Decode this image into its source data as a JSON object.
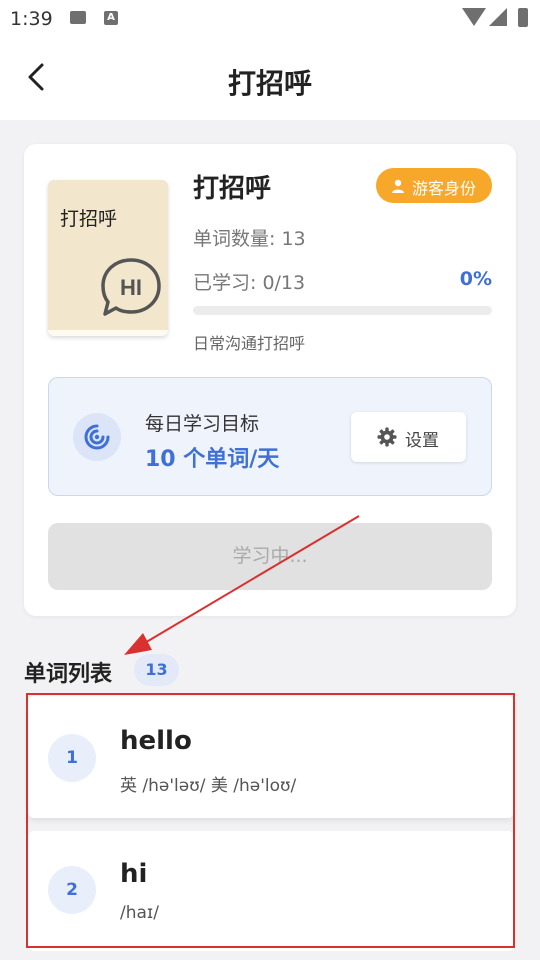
{
  "status_bar": {
    "time": "1:39",
    "icons": [
      "image-icon",
      "a-icon",
      "wifi-icon",
      "signal-icon",
      "battery-icon"
    ]
  },
  "header": {
    "back_icon": "chevron-left-icon",
    "title": "打招呼"
  },
  "book": {
    "cover_title": "打招呼",
    "cover_icon": "hi-chat-bubble-icon",
    "title": "打招呼",
    "guest_badge": "游客身份",
    "guest_icon": "user-icon",
    "word_count": "单词数量: 13",
    "learned": "已学习: 0/13",
    "progress_percent": "0%",
    "progress_fraction": 0,
    "description": "日常沟通打招呼"
  },
  "daily_goal": {
    "icon": "target-icon",
    "label": "每日学习目标",
    "value": "10 个单词/天",
    "settings_icon": "gear-icon",
    "settings_label": "设置"
  },
  "study_button": {
    "label": "学习中..."
  },
  "word_list": {
    "title": "单词列表",
    "count": "13",
    "items": [
      {
        "index": "1",
        "word": "hello",
        "phonetic": "英 /hə'ləʊ/ 美 /hə'loʊ/"
      },
      {
        "index": "2",
        "word": "hi",
        "phonetic": "/haɪ/"
      }
    ]
  },
  "colors": {
    "accent": "#3f70d8",
    "badge": "#f7a72a",
    "annotation": "#d93030"
  }
}
